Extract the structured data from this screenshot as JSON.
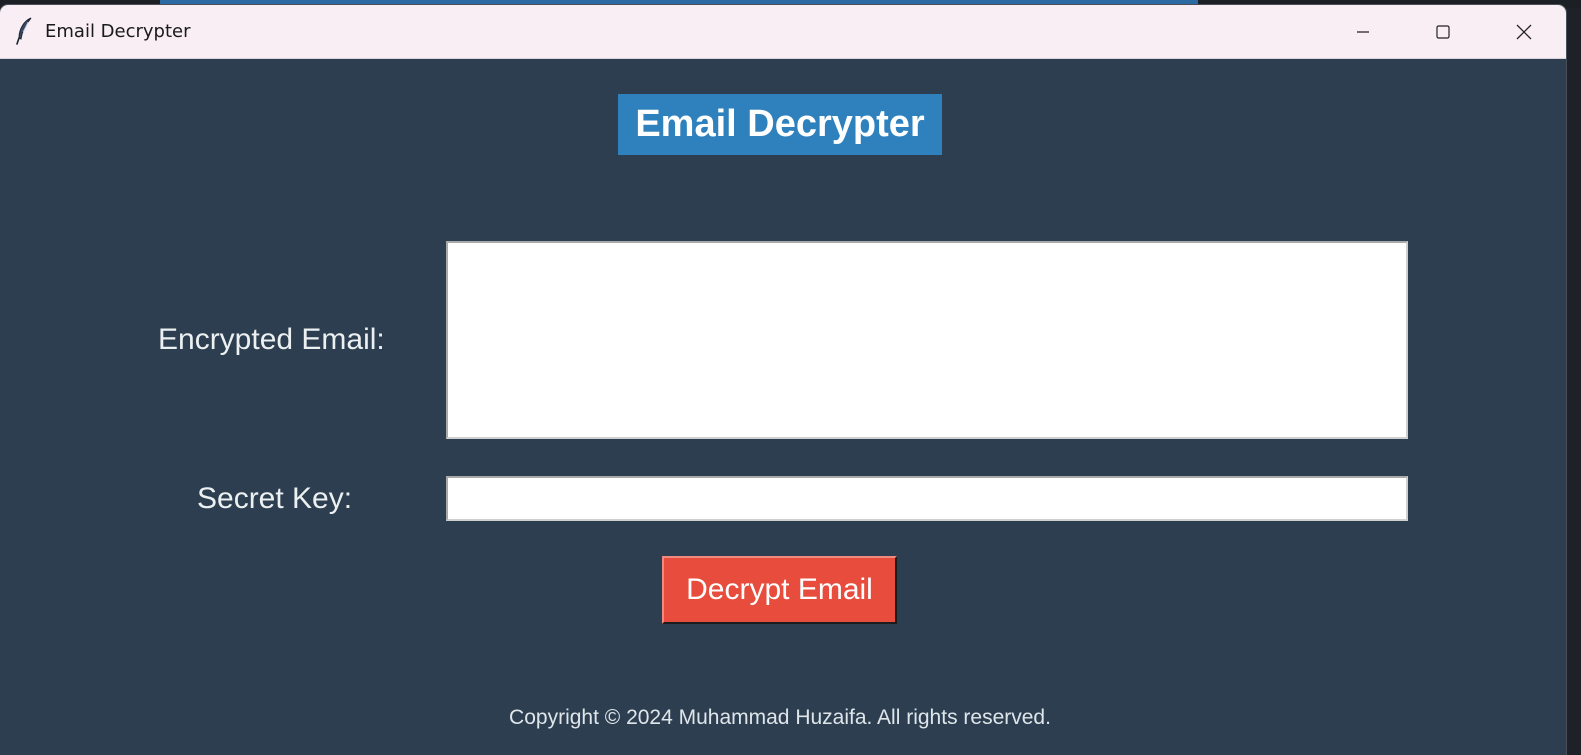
{
  "window": {
    "title": "Email Decrypter",
    "icon": "feather-icon",
    "controls": [
      "minimize-icon",
      "maximize-icon",
      "close-icon"
    ]
  },
  "app": {
    "heading": "Email Decrypter",
    "encrypted_email_label": "Encrypted Email:",
    "encrypted_email_value": "",
    "secret_key_label": "Secret Key:",
    "secret_key_value": "",
    "decrypt_button_label": "Decrypt Email",
    "copyright": "Copyright © 2024 Muhammad Huzaifa. All rights reserved."
  },
  "colors": {
    "background": "#2c3e50",
    "heading_bg": "#2e81bc",
    "button_bg": "#e74c3c",
    "titlebar_bg": "#f8eef3",
    "text": "#ecf0f1"
  }
}
